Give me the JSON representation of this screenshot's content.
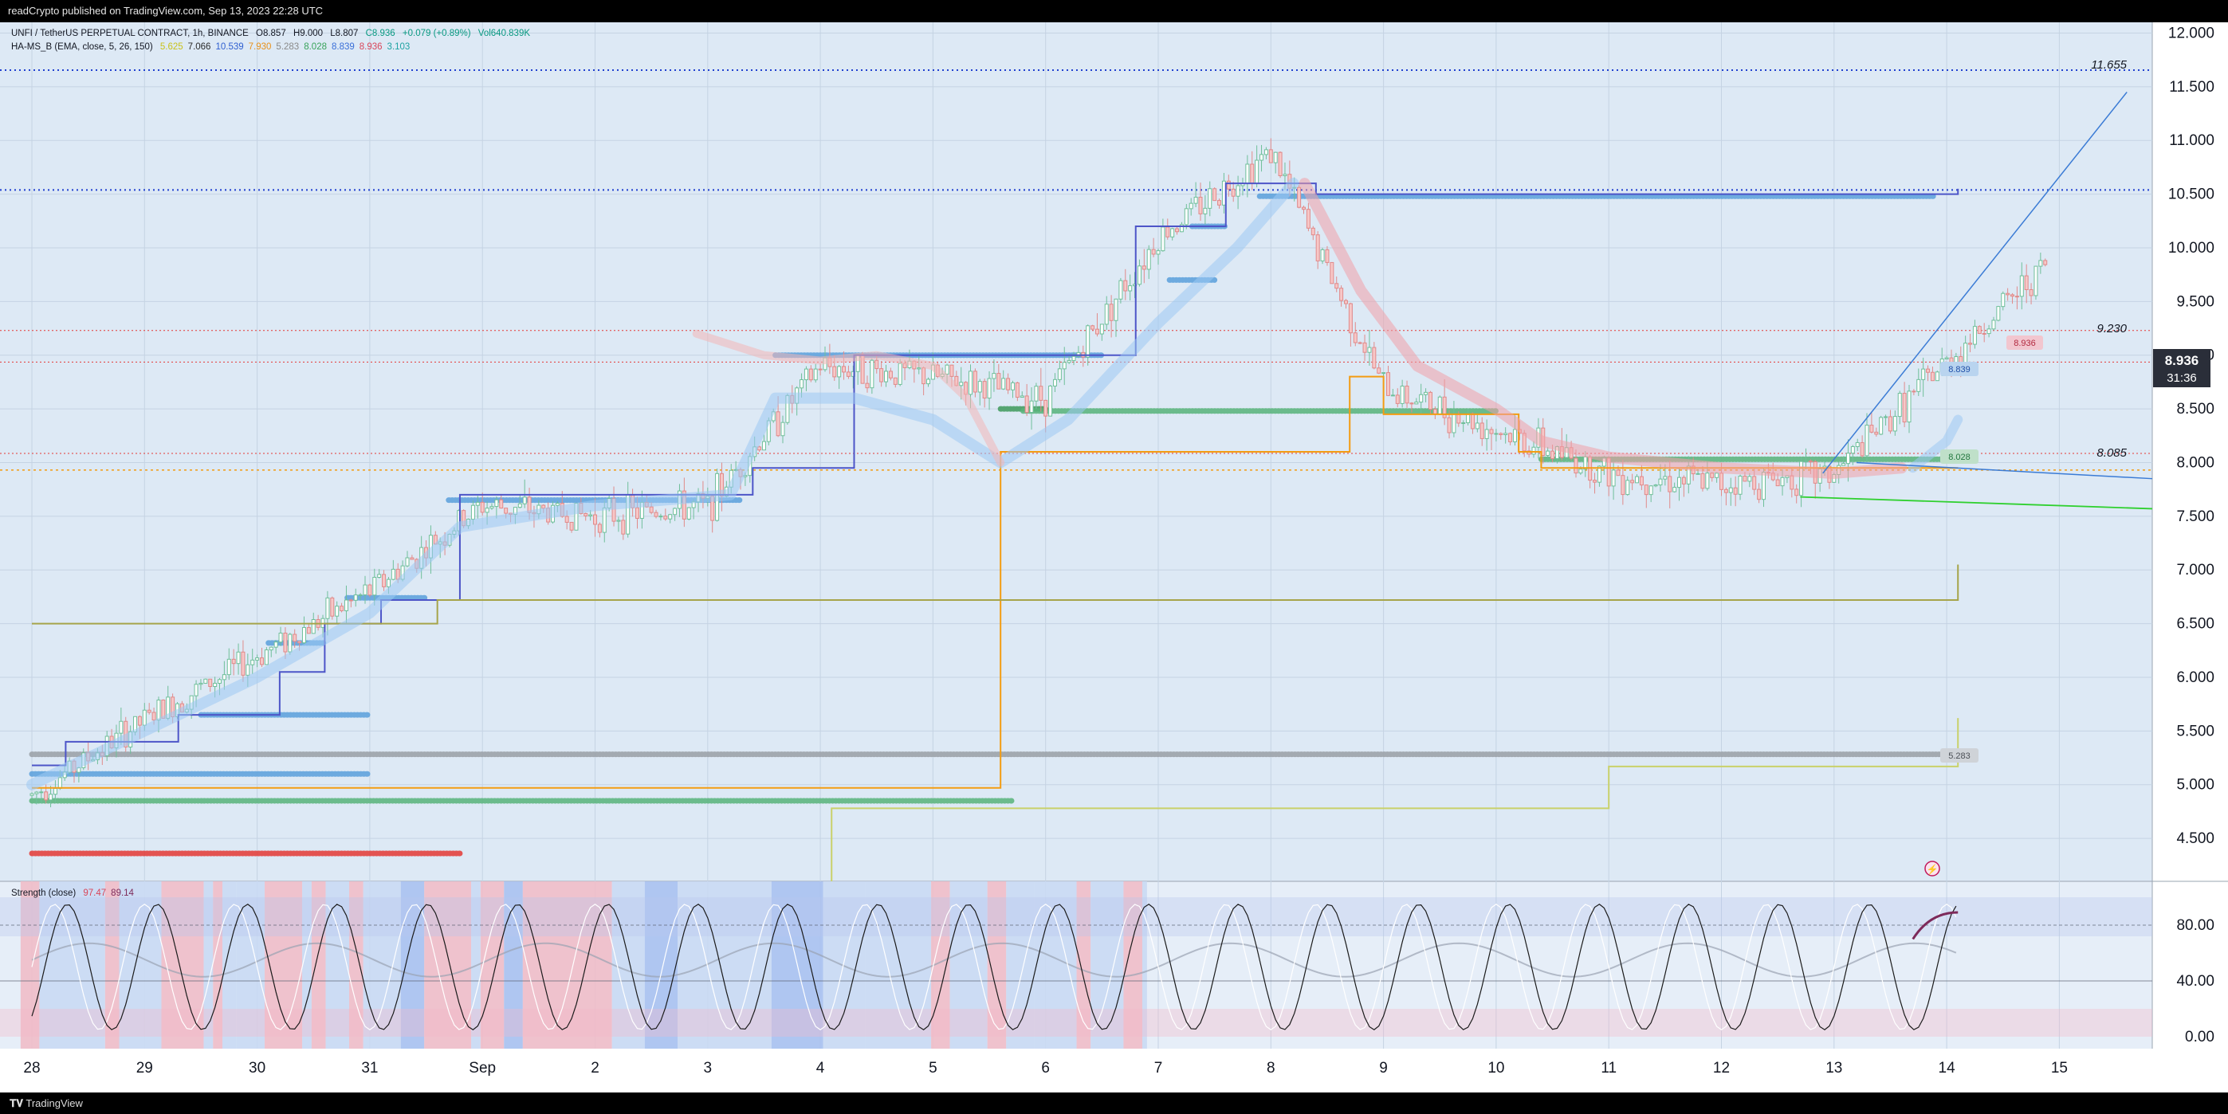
{
  "header": {
    "publish_text": "readCrypto published on TradingView.com, Sep 13, 2023 22:28 UTC"
  },
  "legend": {
    "symbol": "UNFI / TetherUS PERPETUAL CONTRACT, 1h, BINANCE",
    "open": "O8.857",
    "high": "H9.000",
    "low": "L8.807",
    "close": "C8.936",
    "change": "+0.079 (+0.89%)",
    "volume": "Vol640.839K",
    "indicator_name": "HA-MS_B (EMA, close, 5, 26, 150)",
    "indicator_values": [
      "5.625",
      "7.066",
      "10.539",
      "7.930",
      "5.283",
      "8.028",
      "8.839",
      "8.936",
      "3.103"
    ],
    "indicator_colors": [
      "#c9c21a",
      "#2a2a2a",
      "#2f5fd0",
      "#e8911a",
      "#8a8a8a",
      "#38a35a",
      "#3a6fd8",
      "#d9465a",
      "#1fa3a3"
    ],
    "strength_name": "Strength (close)",
    "strength_values": [
      "97.47",
      "89.14"
    ],
    "strength_colors": [
      "#d9465a",
      "#7d2a5a"
    ]
  },
  "price_axis": {
    "ticks": [
      "12.000",
      "11.500",
      "11.000",
      "10.500",
      "10.000",
      "9.500",
      "9.000",
      "8.500",
      "8.000",
      "7.500",
      "7.000",
      "6.500",
      "6.000",
      "5.500",
      "5.000",
      "4.500"
    ],
    "badge_price": "8.936",
    "badge_countdown": "31:36"
  },
  "price_labels": {
    "top_level": "11.655",
    "mid_level": "9.230",
    "low_level": "8.085",
    "tag_current": "8.936",
    "tag_blue": "8.839",
    "tag_green": "8.028",
    "tag_gray": "5.283"
  },
  "strength_axis": {
    "ticks": [
      "80.00",
      "40.00",
      "0.00"
    ]
  },
  "time_axis": {
    "labels": [
      "28",
      "29",
      "30",
      "31",
      "Sep",
      "2",
      "3",
      "4",
      "5",
      "6",
      "7",
      "8",
      "9",
      "10",
      "11",
      "12",
      "13",
      "14",
      "15"
    ]
  },
  "footer": {
    "brand": "TradingView"
  },
  "chart_data": {
    "type": "line",
    "title": "UNFI / TetherUS PERPETUAL CONTRACT, 1h, BINANCE",
    "x": [
      "Aug 28",
      "Aug 29",
      "Aug 30",
      "Aug 31",
      "Sep 1",
      "Sep 2",
      "Sep 3",
      "Sep 4",
      "Sep 5",
      "Sep 6",
      "Sep 7",
      "Sep 8",
      "Sep 9",
      "Sep 10",
      "Sep 11",
      "Sep 12",
      "Sep 13",
      "Sep 13 22:00"
    ],
    "ylim": [
      4.1,
      12.1
    ],
    "y_scale": "linear",
    "grid": true,
    "series": [
      {
        "name": "Close",
        "values": [
          4.9,
          5.6,
          6.2,
          6.8,
          7.6,
          7.5,
          7.6,
          8.9,
          8.8,
          8.6,
          10.1,
          10.9,
          8.7,
          8.3,
          7.9,
          7.8,
          7.9,
          8.936
        ]
      }
    ],
    "horizontal_levels": [
      11.655,
      10.539,
      9.23,
      8.936,
      8.085,
      7.93
    ],
    "strength_series": [
      {
        "name": "Strength (close)",
        "values": [
          97.47,
          89.14
        ]
      }
    ]
  }
}
